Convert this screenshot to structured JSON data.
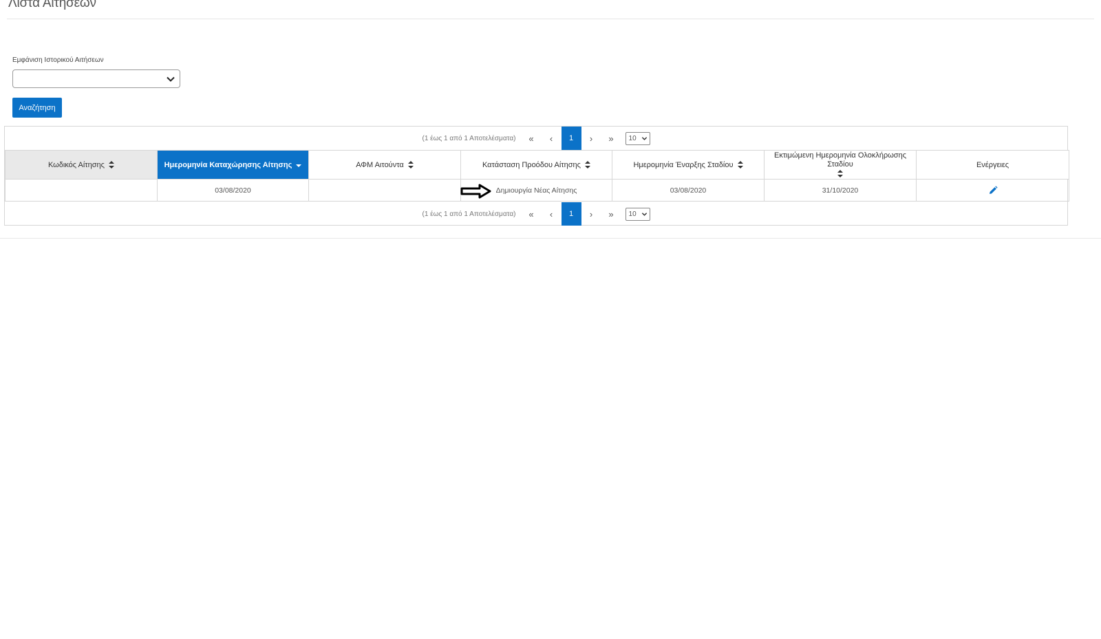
{
  "page": {
    "title": "Λίστα Αιτήσεων"
  },
  "filter": {
    "label": "Εμφάνιση Ιστορικού Αιτήσεων",
    "selected": ""
  },
  "search_button": "Αναζήτηση",
  "pager": {
    "info": "(1 έως 1 από 1 Αποτελέσματα)",
    "first": "«",
    "prev": "‹",
    "current": "1",
    "next": "›",
    "last": "»",
    "rows_per_page": "10"
  },
  "table": {
    "columns": [
      "Κωδικός Αίτησης",
      "Ημερομηνία Καταχώρησης Αίτησης",
      "ΑΦΜ Αιτούντα",
      "Κατάσταση Προόδου Αίτησης",
      "Ημερομηνία Έναρξης Σταδίου",
      "Εκτιμώμενη Ημερομηνία Ολοκλήρωσης Σταδίου",
      "Ενέργειες"
    ],
    "rows": [
      {
        "code": "",
        "submission_date": "03/08/2020",
        "afm": "",
        "status": "Δημιουργία Νέας Αίτησης",
        "stage_start": "03/08/2020",
        "stage_end": "31/10/2020"
      }
    ]
  },
  "colors": {
    "accent": "#0b72c8",
    "header_sorted_bg": "#e9e9e9"
  },
  "icons": {
    "edit": "pencil-icon",
    "dropdown": "chevron-down-icon",
    "sort": "sort-icon",
    "pointer": "arrow-right-icon"
  }
}
